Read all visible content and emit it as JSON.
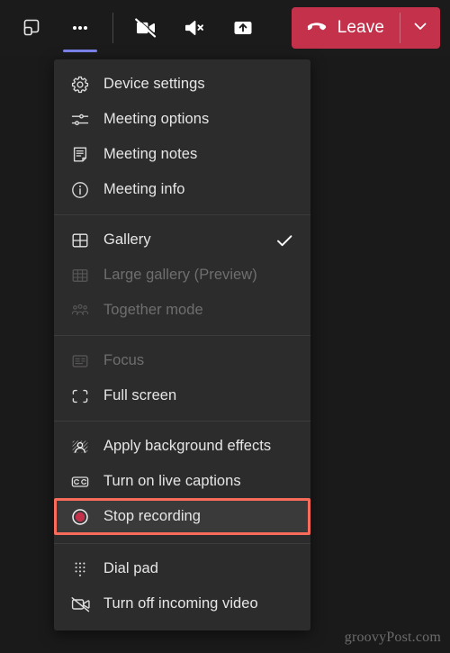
{
  "colors": {
    "page_bg": "#1a1a1a",
    "toolbar_bg": "#1b1b1b",
    "menu_bg": "#2d2c2c",
    "accent_purple": "#7b83eb",
    "leave_red": "#c4314b",
    "highlight_border": "#f96b5b",
    "highlight_row_bg": "#3b3a3a",
    "text": "#e6e6e6",
    "text_disabled": "#6f6e6e"
  },
  "toolbar": {
    "buttons": [
      {
        "name": "pop-out-icon",
        "label": "Pop out",
        "active": false
      },
      {
        "name": "more-options-icon",
        "label": "More options",
        "active": true
      },
      {
        "name": "camera-off-icon",
        "label": "Turn camera on",
        "active": false
      },
      {
        "name": "speaker-mute-icon",
        "label": "Mute",
        "active": false
      },
      {
        "name": "share-content-icon",
        "label": "Share content",
        "active": false
      }
    ],
    "leave": {
      "label": "Leave",
      "icon": "hangup-phone-icon",
      "caret_icon": "chevron-down-icon"
    }
  },
  "menu": {
    "sections": [
      {
        "name": "settings-section",
        "items": [
          {
            "label": "Device settings",
            "icon": "gear-icon",
            "disabled": false,
            "checked": false
          },
          {
            "label": "Meeting options",
            "icon": "sliders-icon",
            "disabled": false,
            "checked": false
          },
          {
            "label": "Meeting notes",
            "icon": "notes-icon",
            "disabled": false,
            "checked": false
          },
          {
            "label": "Meeting info",
            "icon": "info-circle-icon",
            "disabled": false,
            "checked": false
          }
        ]
      },
      {
        "name": "layout-section",
        "items": [
          {
            "label": "Gallery",
            "icon": "gallery-grid-icon",
            "disabled": false,
            "checked": true
          },
          {
            "label": "Large gallery (Preview)",
            "icon": "large-gallery-icon",
            "disabled": true,
            "checked": false
          },
          {
            "label": "Together mode",
            "icon": "together-mode-icon",
            "disabled": true,
            "checked": false
          }
        ]
      },
      {
        "name": "view-section",
        "items": [
          {
            "label": "Focus",
            "icon": "focus-icon",
            "disabled": true,
            "checked": false
          },
          {
            "label": "Full screen",
            "icon": "full-screen-icon",
            "disabled": false,
            "checked": false
          }
        ]
      },
      {
        "name": "media-section",
        "items": [
          {
            "label": "Apply background effects",
            "icon": "background-effects-icon",
            "disabled": false,
            "checked": false
          },
          {
            "label": "Turn on live captions",
            "icon": "closed-captions-icon",
            "disabled": false,
            "checked": false
          },
          {
            "label": "Stop recording",
            "icon": "record-stop-icon",
            "disabled": false,
            "checked": false,
            "highlighted": true
          }
        ]
      },
      {
        "name": "calling-section",
        "items": [
          {
            "label": "Dial pad",
            "icon": "dial-pad-icon",
            "disabled": false,
            "checked": false
          },
          {
            "label": "Turn off incoming video",
            "icon": "incoming-video-off-icon",
            "disabled": false,
            "checked": false
          }
        ]
      }
    ]
  },
  "watermark": {
    "text": "groovyPost.com"
  }
}
